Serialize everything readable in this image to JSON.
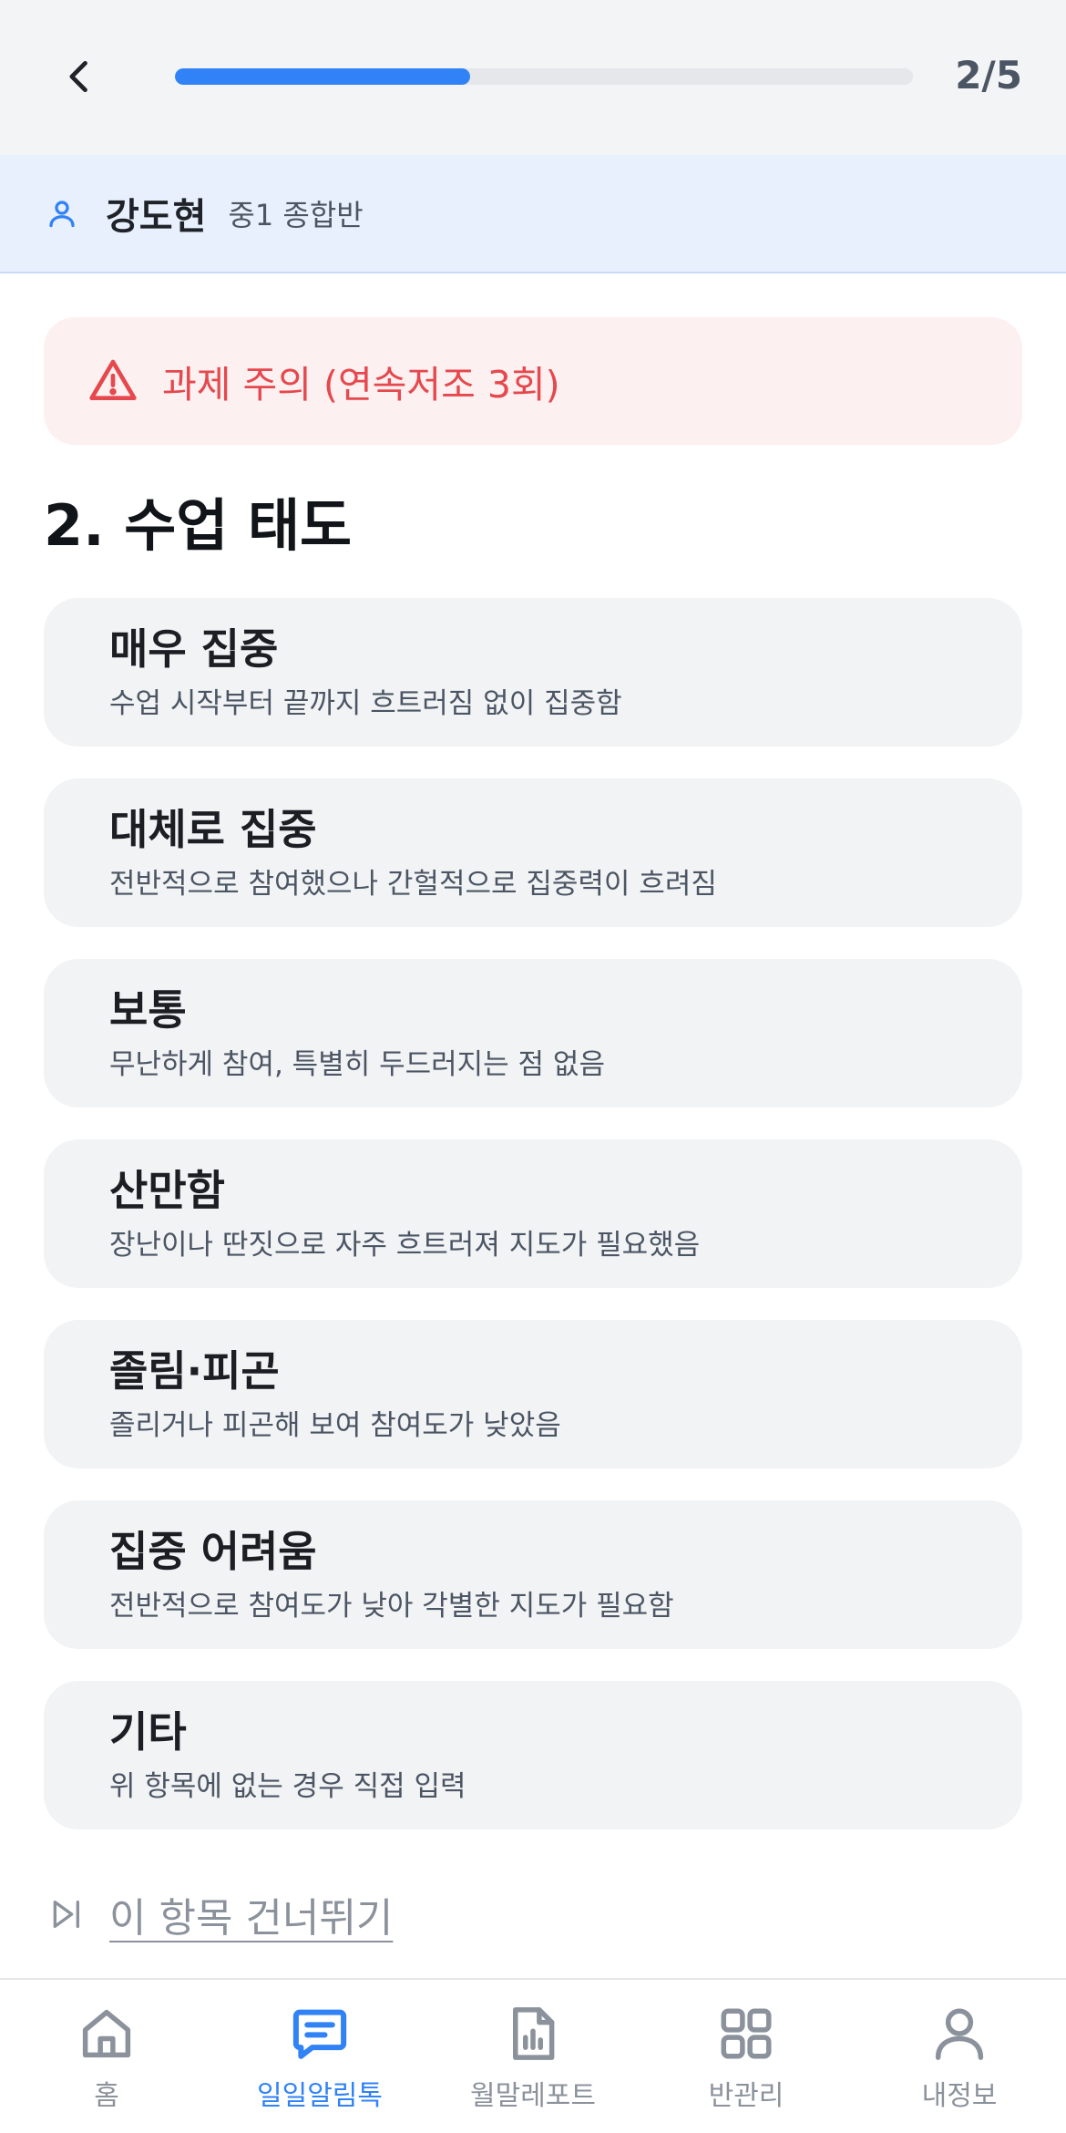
{
  "header": {
    "step_counter": "2/5",
    "progress_fraction": 0.4
  },
  "student": {
    "name": "강도현",
    "class": "중1 종합반"
  },
  "alert": {
    "text": "과제 주의 (연속저조 3회)"
  },
  "section": {
    "title": "2. 수업 태도"
  },
  "options": [
    {
      "title": "매우 집중",
      "desc": "수업 시작부터 끝까지 흐트러짐 없이 집중함"
    },
    {
      "title": "대체로 집중",
      "desc": "전반적으로 참여했으나 간헐적으로 집중력이 흐려짐"
    },
    {
      "title": "보통",
      "desc": "무난하게 참여, 특별히 두드러지는 점 없음"
    },
    {
      "title": "산만함",
      "desc": "장난이나 딴짓으로 자주 흐트러져 지도가 필요했음"
    },
    {
      "title": "졸림·피곤",
      "desc": "졸리거나 피곤해 보여 참여도가 낮았음"
    },
    {
      "title": "집중 어려움",
      "desc": "전반적으로 참여도가 낮아 각별한 지도가 필요함"
    },
    {
      "title": "기타",
      "desc": "위 항목에 없는 경우 직접 입력"
    }
  ],
  "skip": {
    "label": "이 항목 건너뛰기"
  },
  "tabs": [
    {
      "label": "홈",
      "icon": "home-icon"
    },
    {
      "label": "일일알림톡",
      "icon": "message-icon",
      "active": true
    },
    {
      "label": "월말레포트",
      "icon": "report-icon"
    },
    {
      "label": "반관리",
      "icon": "grid-icon"
    },
    {
      "label": "내정보",
      "icon": "profile-icon"
    }
  ],
  "colors": {
    "accent": "#3182f6",
    "alert": "#e5484d",
    "alert_bg": "#fdf0f1",
    "student_bar_bg": "#e8f0fd"
  }
}
